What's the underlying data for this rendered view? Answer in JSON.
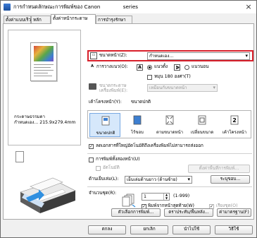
{
  "window": {
    "title": "การกำหนดลักษณะการพิมพ์ของ Canon",
    "title_suffix": "series",
    "close_glyph": "×"
  },
  "tabs": [
    {
      "label": "ตั้งค่าแบบเร็ว"
    },
    {
      "label": "หลัก"
    },
    {
      "label": "ตั้งค่าหน้ากระดาษ"
    },
    {
      "label": "การบำรุงรักษา"
    }
  ],
  "preview": {
    "paper_name": "กระดาษธรรมดา",
    "paper_size": "กำหนดเอง... 215.9x279.4mm"
  },
  "page_size": {
    "label": "ขนาดหน้า(Z):",
    "value": "กำหนดเอง..."
  },
  "orientation": {
    "label": "การวางแนว(O):",
    "portrait": "แนวตั้ง",
    "landscape": "แนวนอน",
    "rotate_label": "หมุน 180 องศา(T)"
  },
  "printer_paper_size": {
    "label": "ขนาดกระดาษเครื่องพิมพ์(E):",
    "value": "เหมือนกับขนาดหน้า"
  },
  "layout": {
    "label": "เค้าโครงหน้า(Y):",
    "value": "ขนาดปกติ",
    "items": [
      {
        "label": "ขนาดปกติ"
      },
      {
        "label": "ไร้ขอบ"
      },
      {
        "label": "ตามขนาดหน้า"
      },
      {
        "label": "เปลี่ยนขนาด"
      },
      {
        "label": "เค้าโครงหน้า"
      }
    ]
  },
  "auto_reduce": {
    "label": "ลดเอกสารที่ใหญ่อัตโนมัติถึงเครื่องพิมพ์ไม่สามารถส่งออก",
    "checked": true
  },
  "duplex": {
    "label": "การพิมพ์ทั้งสองหน้า(U)",
    "auto_label": "อัตโนมัติ",
    "area_button": "ตั้งค่าพื้นที่การพิมพ์..."
  },
  "stapling": {
    "label": "ด้านเย็บเล่ม(L):",
    "value": "เย็บเล่มด้านยาว (ด้านซ้าย)",
    "margin_button": "ระบุขอบ..."
  },
  "copies": {
    "label": "จำนวนชุด(R):",
    "value": "1",
    "range": "(1-999)",
    "last_page_label": "พิมพ์จากหน้าสุดท้าย(W)",
    "collate_label": "เรียงชุด(O)"
  },
  "buttons": {
    "print_options": "ตัวเลือกการพิมพ์...",
    "stamp_background": "ตราประทับ/พื้นหลัง...",
    "defaults": "ค่ามาตรฐาน(F)",
    "ok": "ตกลง",
    "cancel": "ยกเลิก",
    "apply": "นำไปใช้",
    "help": "วิธีใช้"
  },
  "accent_colors": {
    "highlight": "#d8202b",
    "selection": "#d6e8fb"
  }
}
